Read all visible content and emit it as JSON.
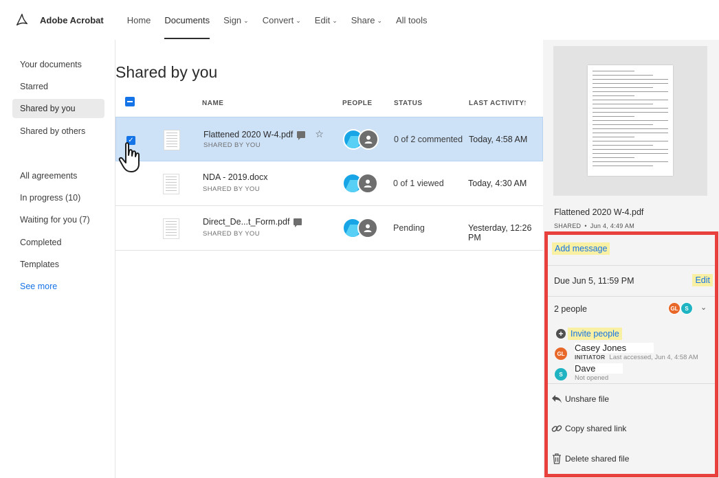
{
  "app": {
    "name": "Adobe Acrobat"
  },
  "nav": [
    {
      "label": "Home",
      "dropdown": false,
      "active": false
    },
    {
      "label": "Documents",
      "dropdown": false,
      "active": true
    },
    {
      "label": "Sign",
      "dropdown": true,
      "active": false
    },
    {
      "label": "Convert",
      "dropdown": true,
      "active": false
    },
    {
      "label": "Edit",
      "dropdown": true,
      "active": false
    },
    {
      "label": "Share",
      "dropdown": true,
      "active": false
    },
    {
      "label": "All tools",
      "dropdown": false,
      "active": false
    }
  ],
  "sidebar": {
    "items": [
      {
        "label": "Your documents"
      },
      {
        "label": "Starred"
      },
      {
        "label": "Shared by you"
      },
      {
        "label": "Shared by others"
      },
      {
        "label": "All agreements"
      },
      {
        "label": "In progress (10)"
      },
      {
        "label": "Waiting for you (7)"
      },
      {
        "label": "Completed"
      },
      {
        "label": "Templates"
      },
      {
        "label": "See more"
      }
    ]
  },
  "main": {
    "title": "Shared by you",
    "columns": {
      "name": "NAME",
      "people": "PEOPLE",
      "status": "STATUS",
      "last_activity": "LAST ACTIVITY"
    },
    "rows": [
      {
        "name": "Flattened 2020 W-4.pdf",
        "sub": "SHARED BY YOU",
        "status": "0 of 2 commented",
        "activity": "Today, 4:58 AM",
        "selected": true,
        "comment": true,
        "star": true
      },
      {
        "name": "NDA - 2019.docx",
        "sub": "SHARED BY YOU",
        "status": "0 of 1 viewed",
        "activity": "Today, 4:30 AM",
        "selected": false,
        "comment": false,
        "star": false
      },
      {
        "name": "Direct_De...t_Form.pdf",
        "sub": "SHARED BY YOU",
        "status": "Pending",
        "activity": "Yesterday, 12:26 PM",
        "selected": false,
        "comment": true,
        "star": false
      }
    ]
  },
  "panel": {
    "file_name": "Flattened 2020 W-4.pdf",
    "shared_label": "SHARED",
    "shared_date": "Jun 4, 4:49 AM",
    "add_message": "Add message",
    "due": "Due Jun 5, 11:59 PM",
    "edit": "Edit",
    "people_count": "2 people",
    "invite": "Invite people",
    "people": [
      {
        "initials": "GL",
        "name": "Casey Jones",
        "role": "INITIATOR",
        "status": "Last accessed, Jun 4, 4:58 AM",
        "color": "#e8682a"
      },
      {
        "initials": "S",
        "name": "Dave",
        "role": "",
        "status": "Not opened",
        "color": "#20b4c2"
      }
    ],
    "actions": {
      "unshare": "Unshare file",
      "copy_link": "Copy shared link",
      "delete": "Delete shared file"
    }
  },
  "colors": {
    "accent": "#1473e6",
    "highlight_box": "#e8403d",
    "selected_row": "#cde1f7",
    "highlight": "#f9f0a4"
  }
}
